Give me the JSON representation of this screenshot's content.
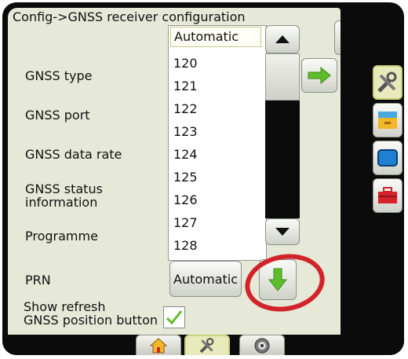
{
  "header": {
    "title": "Config->GNSS receiver configuration"
  },
  "labels": {
    "gnss_type": "GNSS type",
    "gnss_port": "GNSS port",
    "gnss_data_rate": "GNSS data rate",
    "gnss_status_info": "GNSS status\ninformation",
    "programme": "Programme",
    "prn": "PRN",
    "show_refresh": "Show refresh\nGNSS position button"
  },
  "prn_dropdown": {
    "selected": "Automatic",
    "options": [
      "120",
      "121",
      "122",
      "123",
      "124",
      "125",
      "126",
      "127",
      "128"
    ]
  },
  "prn_field": {
    "value": "Automatic"
  },
  "show_refresh_checked": true,
  "tabs": [
    "home",
    "config",
    "gnss"
  ],
  "colors": {
    "accent_green": "#5ebd2a",
    "annotation_red": "#d2232a",
    "panel": "#e6e8d8"
  }
}
